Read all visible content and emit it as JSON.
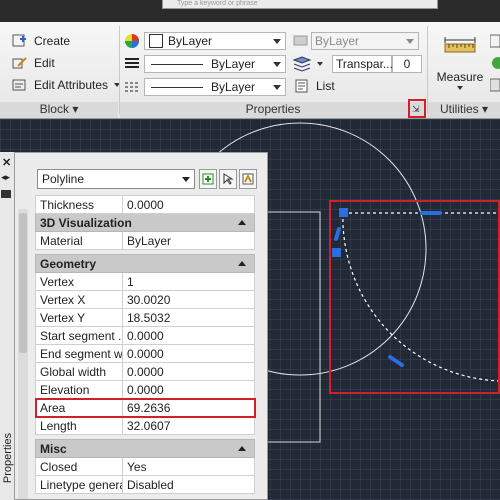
{
  "top": {
    "search_placeholder": "Type a keyword or phrase"
  },
  "ribbon": {
    "block": {
      "create_label": "Create",
      "edit_label": "Edit",
      "edit_attributes_label": "Edit Attributes",
      "title": "Block"
    },
    "properties": {
      "color_value": "ByLayer",
      "linetype_value": "ByLayer",
      "lineweight_value": "ByLayer",
      "plotstyle_value": "ByLayer",
      "transparency_label": "Transpar...",
      "transparency_value": "0",
      "list_label": "List",
      "title": "Properties"
    },
    "utilities": {
      "measure_label": "Measure",
      "title": "Utilities"
    }
  },
  "palette": {
    "side_title": "Properties",
    "object_type": "Polyline",
    "rows_top": [
      {
        "label": "Thickness",
        "value": "0.0000"
      }
    ],
    "section_3d": "3D Visualization",
    "rows_3d": [
      {
        "label": "Material",
        "value": "ByLayer"
      }
    ],
    "section_geometry": "Geometry",
    "rows_geometry": [
      {
        "label": "Vertex",
        "value": "1"
      },
      {
        "label": "Vertex X",
        "value": "30.0020"
      },
      {
        "label": "Vertex Y",
        "value": "18.5032"
      },
      {
        "label": "Start segment ...",
        "value": "0.0000"
      },
      {
        "label": "End segment wi...",
        "value": "0.0000"
      },
      {
        "label": "Global width",
        "value": "0.0000"
      },
      {
        "label": "Elevation",
        "value": "0.0000"
      },
      {
        "label": "Area",
        "value": "69.2636"
      },
      {
        "label": "Length",
        "value": "32.0607"
      }
    ],
    "section_misc": "Misc",
    "rows_misc": [
      {
        "label": "Closed",
        "value": "Yes"
      },
      {
        "label": "Linetype genera...",
        "value": "Disabled"
      }
    ]
  },
  "colors": {
    "highlight_red": "#d0202b",
    "grip_blue": "#2a6ee0",
    "canvas_bg": "#212836"
  }
}
